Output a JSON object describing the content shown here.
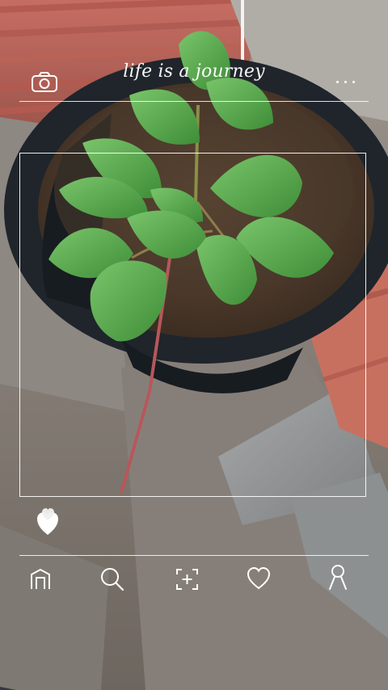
{
  "header": {
    "title": "life is a journey",
    "camera_icon": "camera-icon",
    "menu_icon": "more-dots-icon"
  },
  "actions": {
    "like_icon": "heart-icon"
  },
  "bottom_nav": {
    "items": [
      {
        "icon": "home-icon"
      },
      {
        "icon": "search-icon"
      },
      {
        "icon": "add-frame-icon"
      },
      {
        "icon": "heart-outline-icon"
      },
      {
        "icon": "profile-icon"
      }
    ]
  },
  "colors": {
    "overlay": "#ffffff",
    "pot": "#1f252b",
    "soil": "#4a3a2c",
    "leaf": "#5aa94c",
    "brick": "#cf6b57"
  }
}
